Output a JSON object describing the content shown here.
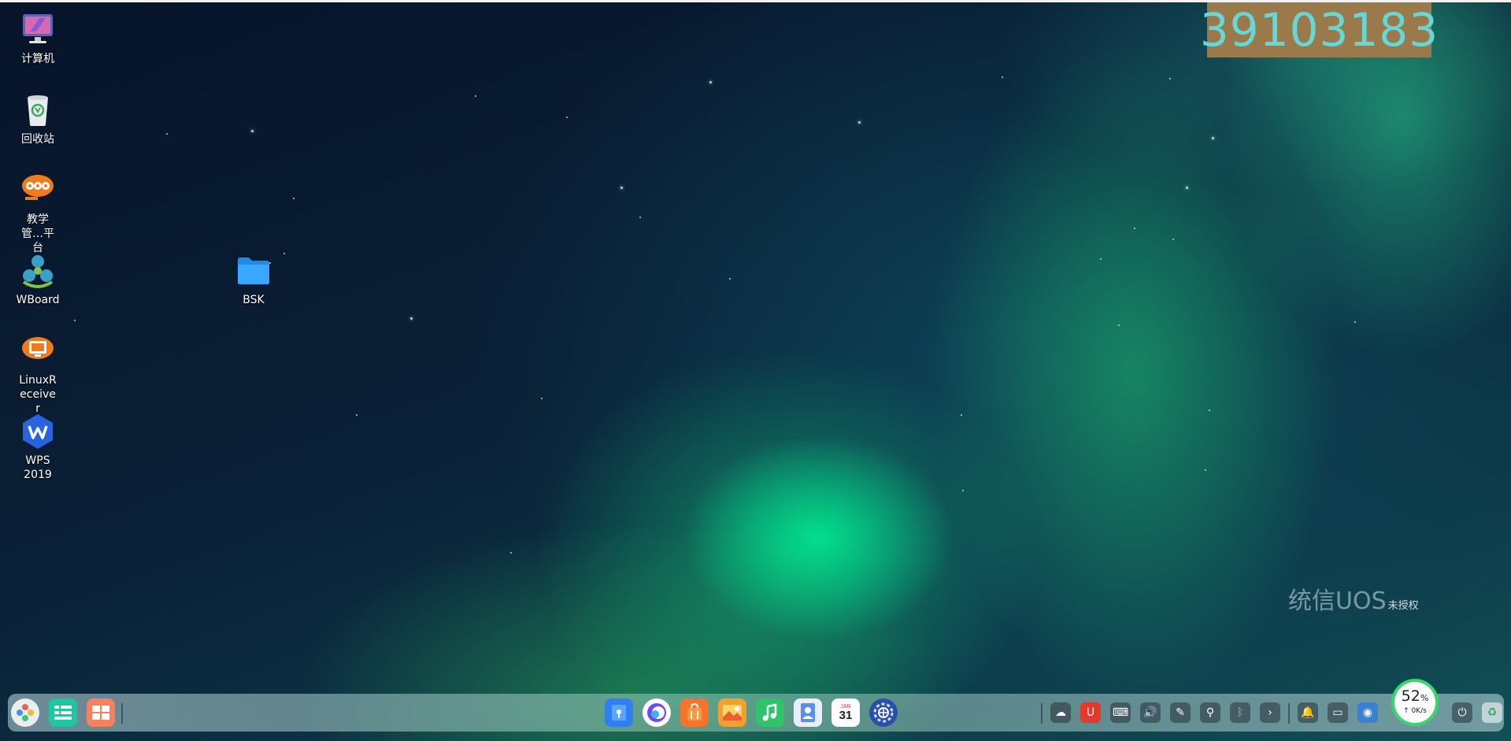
{
  "watermark_number": "39103183",
  "desktop_icons": [
    {
      "label": "计算机",
      "icon": "computer-icon"
    },
    {
      "label": "回收站",
      "icon": "trash-icon"
    },
    {
      "label": "教学管…平台",
      "icon": "teaching-platform-icon"
    },
    {
      "label": "WBoard",
      "icon": "wboard-icon"
    },
    {
      "label": "LinuxReceiver",
      "icon": "linux-receiver-icon"
    },
    {
      "label": "WPS 2019",
      "icon": "wps-icon"
    },
    {
      "label": "BSK",
      "icon": "folder-icon"
    }
  ],
  "os_brand": {
    "logo_text": "统信UOS",
    "status": "未授权"
  },
  "dock": {
    "left_apps": [
      "launcher-icon",
      "multitask-view-icon",
      "workspace-icon"
    ],
    "center_apps": [
      "file-manager-icon",
      "browser-icon",
      "app-store-icon",
      "image-viewer-icon",
      "music-icon",
      "contacts-icon",
      "calendar-icon",
      "settings-icon"
    ],
    "calendar": {
      "month": "JAN",
      "day": "31"
    },
    "tray": [
      "cloud-icon",
      "magnet-icon",
      "keyboard-icon",
      "volume-icon",
      "pen-icon",
      "usb-icon",
      "bluetooth-icon",
      "expand-arrow-icon",
      "notification-icon",
      "screen-icon",
      "network-icon",
      "power-icon",
      "trash-dock-icon"
    ]
  },
  "net_widget": {
    "percent": "52",
    "unit": "%",
    "rate": "↑ 0K/s"
  },
  "colors": {
    "watermark_bg": "#9a7a4a",
    "watermark_text": "#66d6d6",
    "widget_ring": "#3ad56e"
  }
}
